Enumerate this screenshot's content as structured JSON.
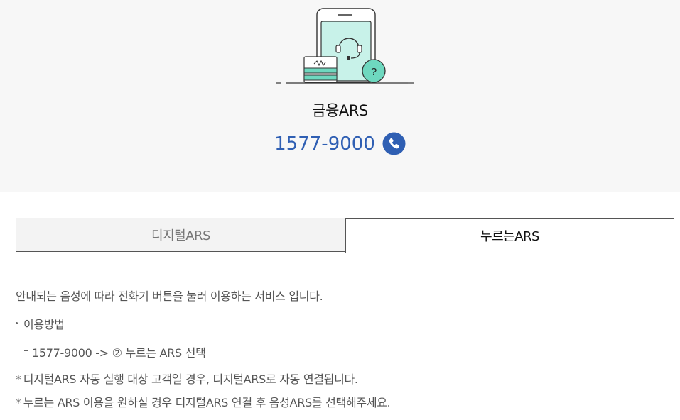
{
  "header": {
    "title": "금융ARS",
    "phone_number": "1577-9000",
    "phone_color": "#2f5fb3"
  },
  "icons": {
    "illustration": "phone-headset-card-question-illustration",
    "call": "phone-call-icon"
  },
  "tabs": [
    {
      "label": "디지털ARS",
      "active": false
    },
    {
      "label": "누르는ARS",
      "active": true
    }
  ],
  "content": {
    "intro": "안내되는 음성에 따라 전화기 버튼을 눌러 이용하는 서비스 입니다.",
    "usage_heading": "이용방법",
    "usage_step": "1577-9000 -> ② 누르는 ARS 선택",
    "note1_mark": "*",
    "note1": "디지털ARS 자동 실행 대상 고객일 경우, 디지털ARS로 자동 연결됩니다.",
    "note2_mark": "*",
    "note2": "누르는 ARS 이용을 원하실 경우 디지털ARS 연결 후 음성ARS를 선택해주세요."
  }
}
